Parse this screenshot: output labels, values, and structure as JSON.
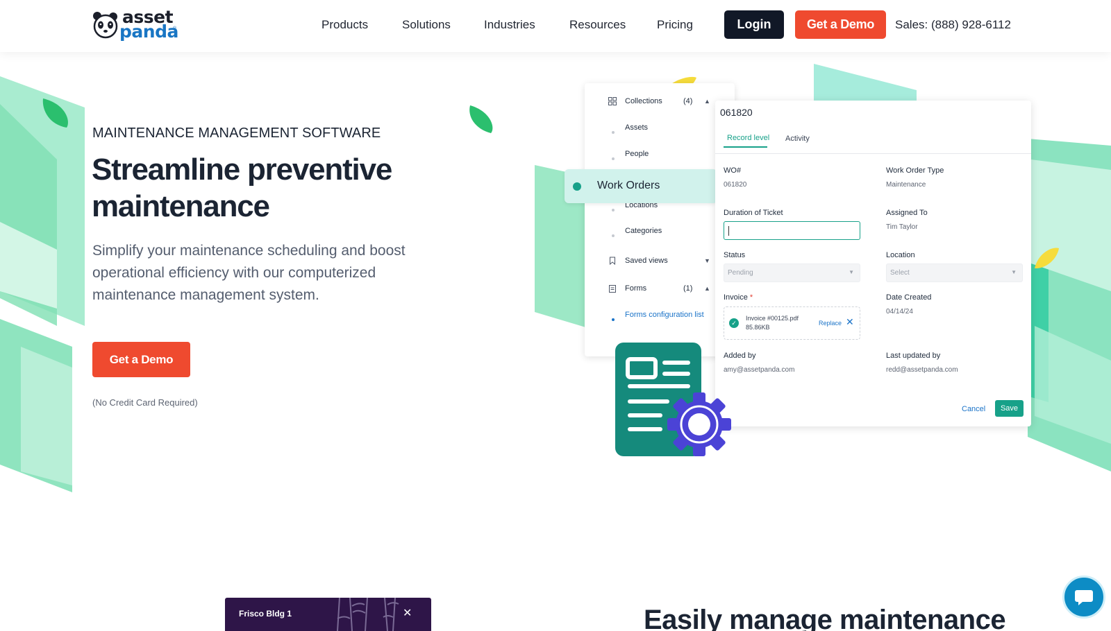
{
  "brand": {
    "name_line1": "asset",
    "name_line2": "panda",
    "reg": "®"
  },
  "nav": {
    "items": [
      {
        "label": "Products"
      },
      {
        "label": "Solutions"
      },
      {
        "label": "Industries"
      },
      {
        "label": "Resources"
      },
      {
        "label": "Pricing"
      }
    ],
    "login_label": "Login",
    "demo_label": "Get a Demo",
    "sales_text": "Sales: (888) 928-6112"
  },
  "hero": {
    "eyebrow": "MAINTENANCE MANAGEMENT SOFTWARE",
    "title": "Streamline preventive maintenance",
    "subtitle": "Simplify your maintenance scheduling and boost operational efficiency with our computerized maintenance management system.",
    "cta_label": "Get a Demo",
    "note": "(No Credit Card Required)"
  },
  "mock_sidebar": {
    "collections": {
      "label": "Collections",
      "count": "(4)"
    },
    "items": [
      {
        "label": "Assets"
      },
      {
        "label": "People"
      },
      {
        "label": "Locations"
      },
      {
        "label": "Categories"
      }
    ],
    "active_item": "Work Orders",
    "saved_views": "Saved views",
    "forms": {
      "label": "Forms",
      "count": "(1)"
    },
    "forms_config": "Forms configuration list"
  },
  "mock_record": {
    "title": "061820",
    "tabs": {
      "record_level": "Record level",
      "activity": "Activity"
    },
    "fields": {
      "wo_label": "WO#",
      "wo_value": "061820",
      "type_label": "Work Order Type",
      "type_value": "Maintenance",
      "duration_label": "Duration of Ticket",
      "assigned_label": "Assigned To",
      "assigned_value": "Tim Taylor",
      "status_label": "Status",
      "status_value": "Pending",
      "location_label": "Location",
      "location_placeholder": "Select",
      "invoice_label": "Invoice",
      "invoice_required": "*",
      "invoice_file": "Invoice #00125.pdf",
      "invoice_size": "85.86KB",
      "invoice_replace": "Replace",
      "date_label": "Date Created",
      "date_value": "04/14/24",
      "added_label": "Added by",
      "added_value": "amy@assetpanda.com",
      "updated_label": "Last updated by",
      "updated_value": "redd@assetpanda.com"
    },
    "cancel_label": "Cancel",
    "save_label": "Save"
  },
  "bottom": {
    "property_card": "Frisco Bldg 1",
    "heading": "Easily manage maintenance"
  },
  "colors": {
    "accent_teal": "#17a189",
    "cta_orange": "#ef4a2f",
    "login_dark": "#111827",
    "brand_blue": "#1976c4",
    "deco_green": "#6fdca8"
  },
  "icons": [
    "panda-logo-icon",
    "grid-icon",
    "chevron-up-icon",
    "chevron-down-icon",
    "bookmark-icon",
    "clipboard-icon",
    "check-circle-icon",
    "close-icon",
    "document-gear-icon",
    "chat-icon",
    "leaf-icon"
  ]
}
